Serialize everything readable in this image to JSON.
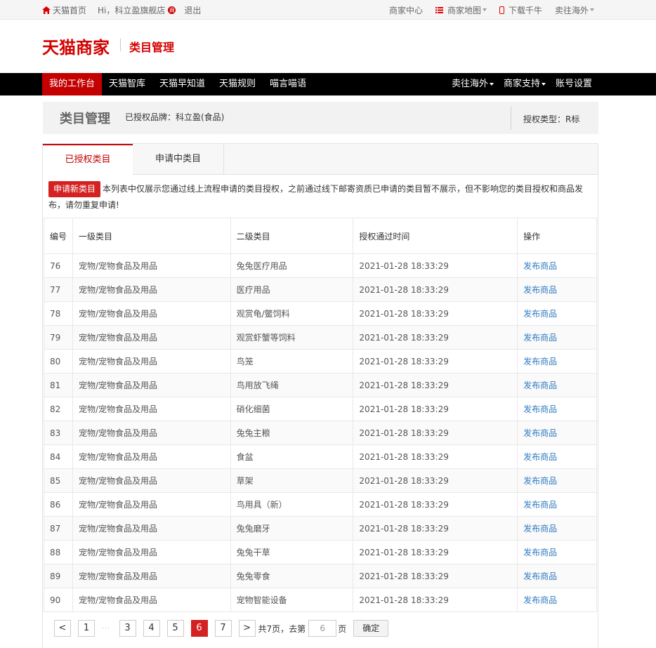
{
  "topbar": {
    "home": "天猫首页",
    "greeting": "Hi，科立盈旗舰店",
    "greeting_badge": "商",
    "logout": "退出",
    "merchant_center": "商家中心",
    "merchant_map": "商家地图",
    "download": "下载千牛",
    "overseas": "卖往海外"
  },
  "header": {
    "logo": "天猫商家",
    "subtitle": "类目管理"
  },
  "nav": {
    "left": [
      "我的工作台",
      "天猫智库",
      "天猫早知道",
      "天猫规则",
      "喵言喵语"
    ],
    "right": [
      "卖往海外",
      "商家支持",
      "账号设置"
    ]
  },
  "headbox": {
    "title": "类目管理",
    "brand": "已授权品牌：科立盈(食品)",
    "auth_type": "授权类型：R标"
  },
  "tabs": [
    "已授权类目",
    "申请中类目"
  ],
  "notice": {
    "button": "申请新类目",
    "text": "本列表中仅展示您通过线上流程申请的类目授权，之前通过线下邮寄资质已申请的类目暂不展示，但不影响您的类目授权和商品发布，请勿重复申请!"
  },
  "table": {
    "headers": [
      "编号",
      "一级类目",
      "二级类目",
      "授权通过时间",
      "操作"
    ],
    "rows": [
      {
        "num": "76",
        "cat1": "宠物/宠物食品及用品",
        "cat2": "兔兔医疗用品",
        "time": "2021-01-28 18:33:29",
        "op": "发布商品"
      },
      {
        "num": "77",
        "cat1": "宠物/宠物食品及用品",
        "cat2": "医疗用品",
        "time": "2021-01-28 18:33:29",
        "op": "发布商品"
      },
      {
        "num": "78",
        "cat1": "宠物/宠物食品及用品",
        "cat2": "观赏龟/鳖饲料",
        "time": "2021-01-28 18:33:29",
        "op": "发布商品"
      },
      {
        "num": "79",
        "cat1": "宠物/宠物食品及用品",
        "cat2": "观赏虾蟹等饲料",
        "time": "2021-01-28 18:33:29",
        "op": "发布商品"
      },
      {
        "num": "80",
        "cat1": "宠物/宠物食品及用品",
        "cat2": "鸟笼",
        "time": "2021-01-28 18:33:29",
        "op": "发布商品"
      },
      {
        "num": "81",
        "cat1": "宠物/宠物食品及用品",
        "cat2": "鸟用放飞绳",
        "time": "2021-01-28 18:33:29",
        "op": "发布商品"
      },
      {
        "num": "82",
        "cat1": "宠物/宠物食品及用品",
        "cat2": "硝化细菌",
        "time": "2021-01-28 18:33:29",
        "op": "发布商品"
      },
      {
        "num": "83",
        "cat1": "宠物/宠物食品及用品",
        "cat2": "兔兔主粮",
        "time": "2021-01-28 18:33:29",
        "op": "发布商品"
      },
      {
        "num": "84",
        "cat1": "宠物/宠物食品及用品",
        "cat2": "食盆",
        "time": "2021-01-28 18:33:29",
        "op": "发布商品"
      },
      {
        "num": "85",
        "cat1": "宠物/宠物食品及用品",
        "cat2": "草架",
        "time": "2021-01-28 18:33:29",
        "op": "发布商品"
      },
      {
        "num": "86",
        "cat1": "宠物/宠物食品及用品",
        "cat2": "鸟用具（新）",
        "time": "2021-01-28 18:33:29",
        "op": "发布商品"
      },
      {
        "num": "87",
        "cat1": "宠物/宠物食品及用品",
        "cat2": "兔兔磨牙",
        "time": "2021-01-28 18:33:29",
        "op": "发布商品"
      },
      {
        "num": "88",
        "cat1": "宠物/宠物食品及用品",
        "cat2": "兔兔干草",
        "time": "2021-01-28 18:33:29",
        "op": "发布商品"
      },
      {
        "num": "89",
        "cat1": "宠物/宠物食品及用品",
        "cat2": "兔兔零食",
        "time": "2021-01-28 18:33:29",
        "op": "发布商品"
      },
      {
        "num": "90",
        "cat1": "宠物/宠物食品及用品",
        "cat2": "宠物智能设备",
        "time": "2021-01-28 18:33:29",
        "op": "发布商品"
      }
    ]
  },
  "pager": {
    "prev": "<",
    "first": "1",
    "dots": "···",
    "pages": [
      "3",
      "4",
      "5",
      "6",
      "7"
    ],
    "current": "6",
    "next": ">",
    "total_text": "共7页，去第",
    "input_value": "6",
    "page_unit": "页",
    "confirm": "确定"
  },
  "colors": {
    "brand_red": "#c40000",
    "link_blue": "#2f7ac1",
    "nav_bg": "#000000"
  },
  "icons": {
    "home": "home-icon",
    "badge": "shop-badge-icon",
    "map": "list-icon",
    "download": "phone-icon"
  }
}
